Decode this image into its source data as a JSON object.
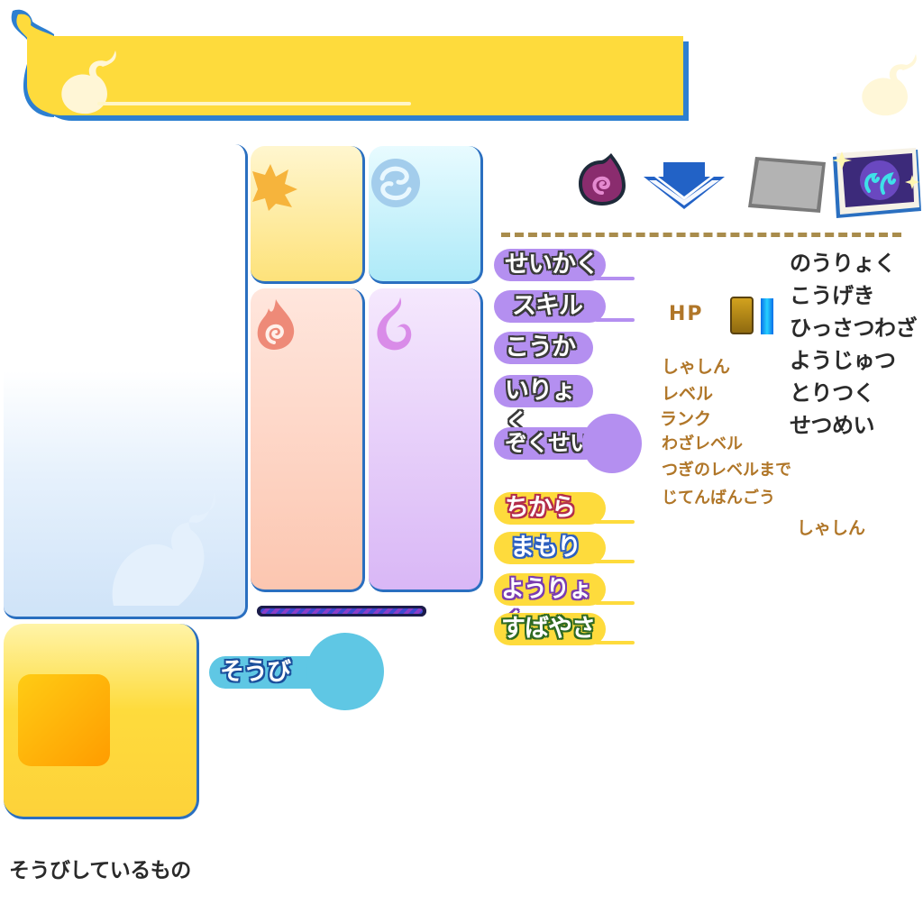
{
  "colors": {
    "banner": "#fedb3c",
    "frame_blue": "#2a6fc0",
    "pill_purple": "#b48ff0",
    "pill_yellow": "#fedb3c",
    "equip_blue": "#5fc7e4",
    "brown_text": "#b07628"
  },
  "icons": {
    "banner_emblem": "yokai-wisp-emblem",
    "sun": "sun-burst-icon",
    "wind": "wind-swirl-icon",
    "fire": "fire-spiral-icon",
    "spirit": "spirit-flame-icon",
    "soul": "soul-orb-icon",
    "arrow": "down-arrow-icon",
    "card_gray": "blank-card-icon",
    "card_spirit": "spirit-card-icon"
  },
  "labels": {
    "personality": "せいかく",
    "skill": "スキル",
    "effect": "こうか",
    "power": "いりょく",
    "attribute": "ぞくせい",
    "strength": "ちから",
    "defense": "まもり",
    "spirit": "ようりょく",
    "speed": "すばやさ"
  },
  "info": {
    "hp": "HP",
    "photo1": "しゃしん",
    "level": "レベル",
    "rank": "ランク",
    "skill_level": "わざレベル",
    "next_level": "つぎのレベルまで",
    "dex_number": "じてんばんごう",
    "photo2": "しゃしん"
  },
  "abilities": {
    "ability": "のうりょく",
    "attack": "こうげき",
    "soultimate": "ひっさつわざ",
    "technique": "ようじゅつ",
    "inspirit": "とりつく",
    "description": "せつめい"
  },
  "equipment": {
    "label": "そうび",
    "caption": "そうびしているもの"
  }
}
